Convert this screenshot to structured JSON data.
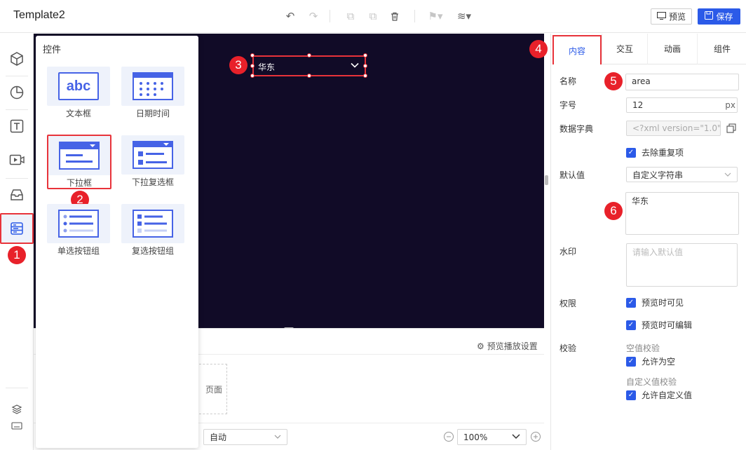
{
  "app": {
    "title": "Template2"
  },
  "toolbar": {
    "preview_label": "预览",
    "save_label": "保存",
    "icons": [
      "undo-icon",
      "redo-icon",
      "copy-icon",
      "paste-icon",
      "delete-icon",
      "align-icon",
      "layer-icon"
    ]
  },
  "sidebar": {
    "items": [
      "component-icon",
      "chart-icon",
      "text-icon",
      "media-icon",
      "container-icon",
      "form-control-icon"
    ],
    "bottom_items": [
      "layers-icon",
      "keyboard-icon"
    ]
  },
  "controls_panel": {
    "title": "控件",
    "items": [
      {
        "label": "文本框",
        "icon": "textbox-icon",
        "icon_text": "abc"
      },
      {
        "label": "日期时间",
        "icon": "calendar-icon"
      },
      {
        "label": "下拉框",
        "icon": "dropdown-icon"
      },
      {
        "label": "下拉复选框",
        "icon": "dropdown-checkbox-icon"
      },
      {
        "label": "单选按钮组",
        "icon": "radio-group-icon"
      },
      {
        "label": "复选按钮组",
        "icon": "checkbox-group-icon"
      }
    ]
  },
  "canvas": {
    "widget_value": "华东",
    "bg_color": "#110b27"
  },
  "bottom": {
    "preview_settings": "预览播放设置",
    "page_partial": "页面",
    "mode_value": "自动",
    "zoom_value": "100%"
  },
  "properties": {
    "tabs": [
      "内容",
      "交互",
      "动画",
      "组件"
    ],
    "active_tab": "内容",
    "name_label": "名称",
    "name_value": "area",
    "font_label": "字号",
    "font_value": "12",
    "font_unit": "px",
    "dict_label": "数据字典",
    "dict_value": "<?xml version=\"1.0\" en",
    "dedupe_label": "去除重复项",
    "default_label": "默认值",
    "default_select": "自定义字符串",
    "default_text": "华东",
    "watermark_label": "水印",
    "watermark_placeholder": "请输入默认值",
    "perm_label": "权限",
    "perm_visible": "预览时可见",
    "perm_edit": "预览时可编辑",
    "validate_label": "校验",
    "empty_check": "空值校验",
    "allow_empty": "允许为空",
    "custom_check": "自定义值校验",
    "allow_custom": "允许自定义值"
  },
  "badges": [
    "1",
    "2",
    "3",
    "4",
    "5",
    "6"
  ],
  "colors": {
    "accent": "#2b5ae8",
    "highlight": "#e8333a",
    "badge": "#e8212a"
  }
}
